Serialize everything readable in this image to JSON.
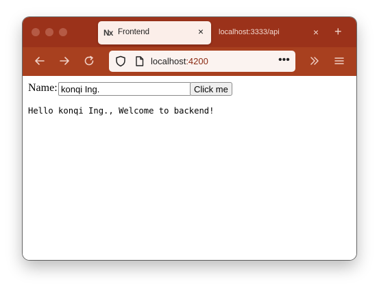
{
  "browser": {
    "tabs": [
      {
        "title": "Frontend",
        "active": true,
        "favicon": "nx-logo-icon",
        "favicon_text": "Nx"
      },
      {
        "title": "localhost:3333/api",
        "active": false
      }
    ],
    "new_tab_glyph": "+",
    "close_glyph": "×",
    "url": {
      "host": "localhost",
      "port": ":4200"
    },
    "more_glyph": "•••",
    "colors": {
      "tabbar": "#9b321a",
      "toolbar": "#a8401f",
      "urlbar": "#fbf3f0",
      "active_tab": "#fbeee9"
    }
  },
  "page": {
    "name_label": "Name:",
    "name_input_value": "konqi Ing.",
    "button_label": "Click me",
    "greeting": "Hello konqi Ing., Welcome to backend!"
  }
}
